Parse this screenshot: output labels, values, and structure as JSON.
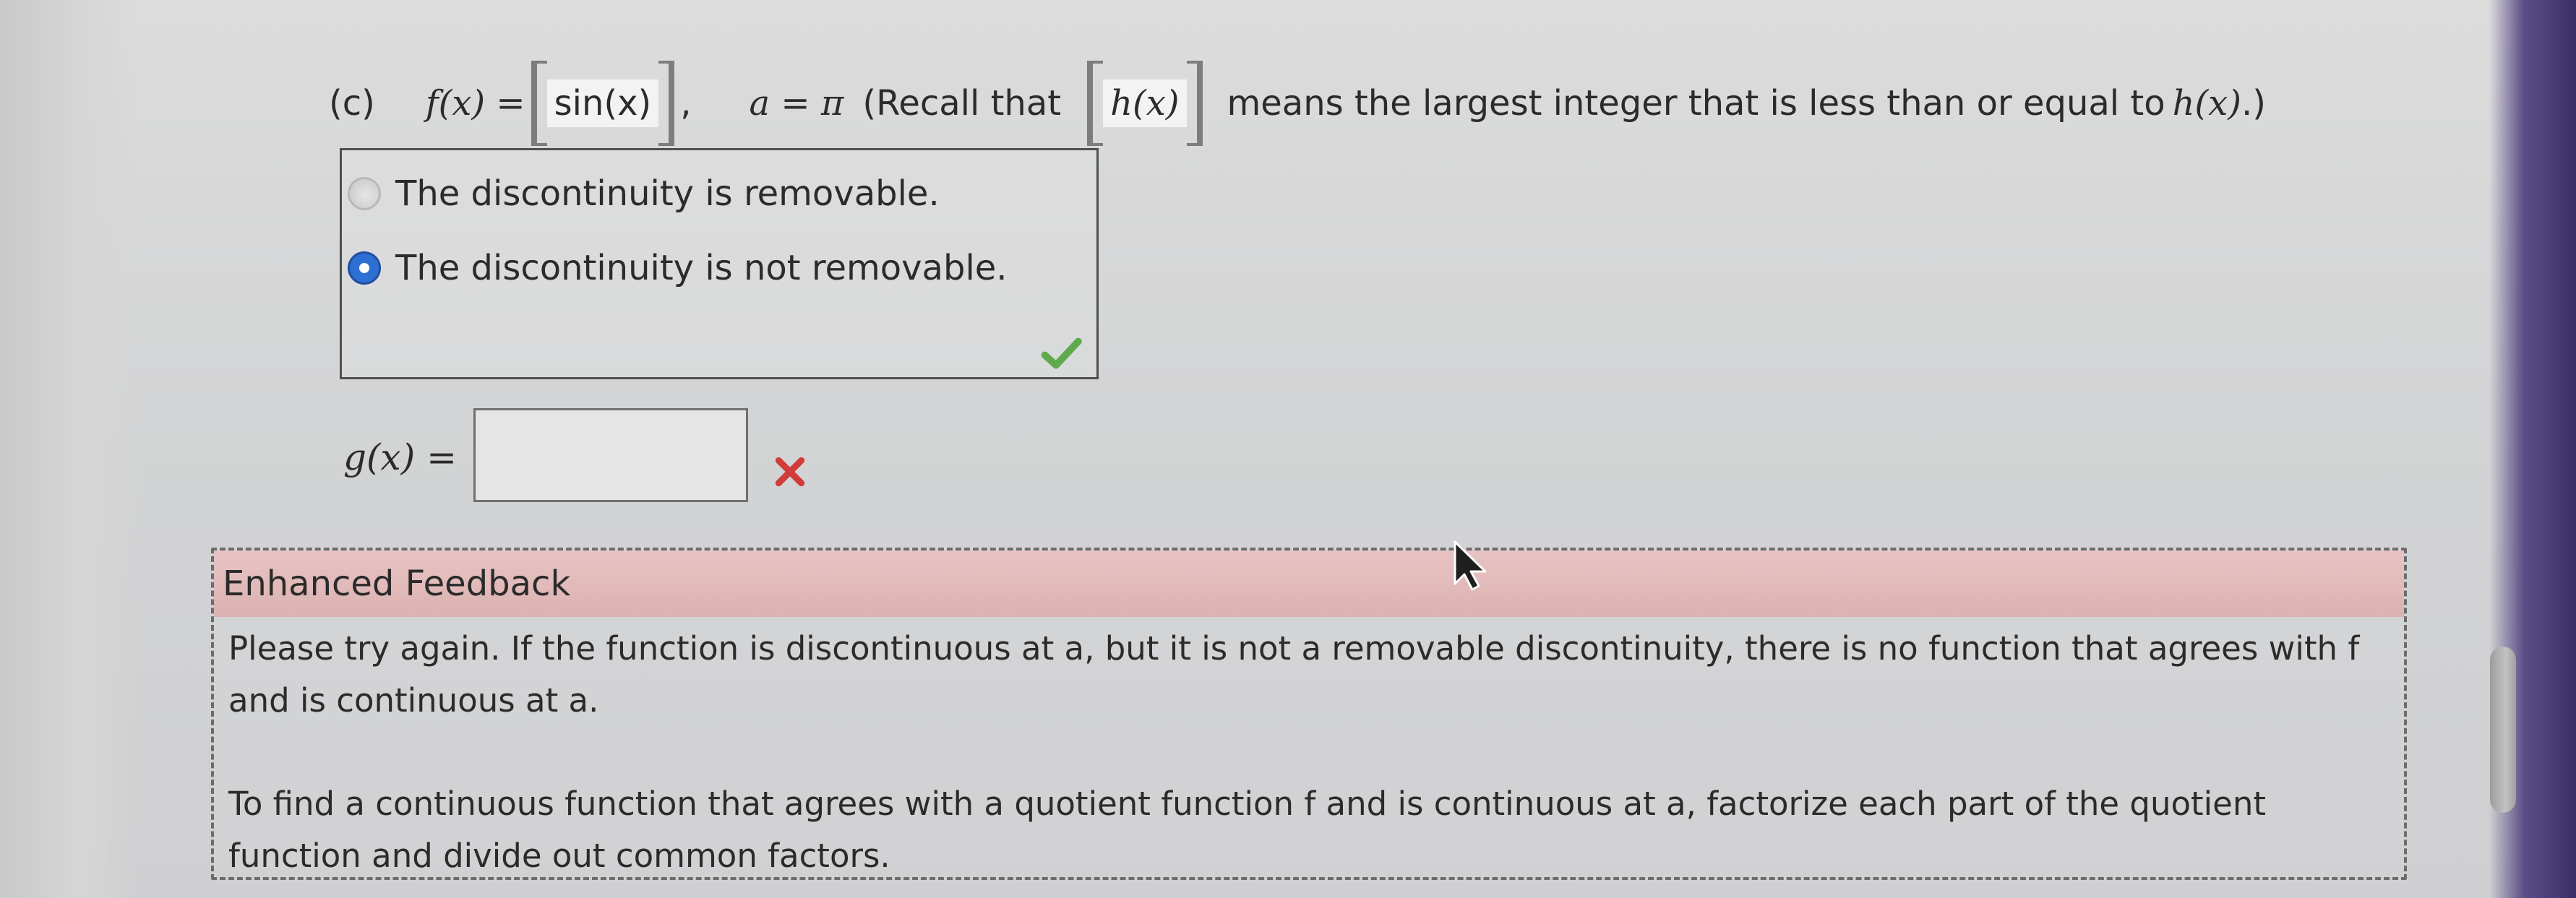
{
  "problem": {
    "part_label": "(c)",
    "f_def_prefix": "f(x) =",
    "floor_inner": "sin(x)",
    "comma": ",",
    "a_def": "a = π",
    "recall_open": "(Recall that",
    "recall_floor_inner": "h(x)",
    "recall_text": "means the largest integer that is less than or equal to",
    "recall_hx": "h(x)",
    "recall_close": ".)"
  },
  "radio": {
    "options": [
      {
        "label": "The discontinuity is removable.",
        "selected": false
      },
      {
        "label": "The discontinuity is not removable.",
        "selected": true
      }
    ],
    "check_icon": "check-icon",
    "check_color": "#5fa94d"
  },
  "gx": {
    "label": "g(x) =",
    "value": "",
    "placeholder": "",
    "status_icon": "x-icon",
    "status_color": "#d23b3b"
  },
  "feedback": {
    "title": "Enhanced Feedback",
    "paragraph1": "Please try again. If the function is discontinuous at a, but it is not a removable discontinuity, there is no function that agrees with f and is continuous at a.",
    "paragraph2": "To find a continuous function that agrees with a quotient function f and is continuous at a, factorize each part of the quotient function and divide out common factors."
  }
}
